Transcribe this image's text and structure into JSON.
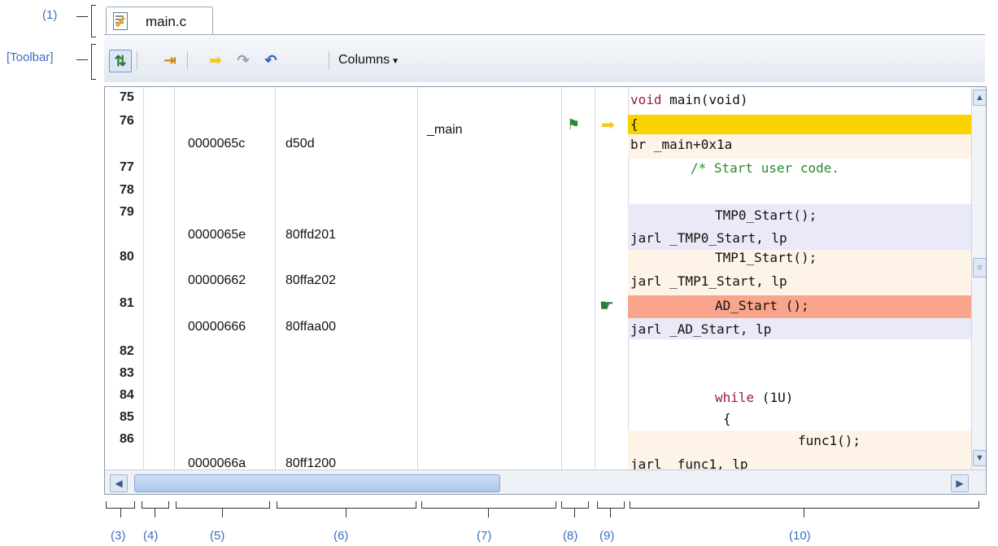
{
  "callouts": {
    "c1": "(1)",
    "toolbar": "[Toolbar]",
    "c3": "(3)",
    "c4": "(4)",
    "c5": "(5)",
    "c6": "(6)",
    "c7": "(7)",
    "c8": "(8)",
    "c9": "(9)",
    "c10": "(10)"
  },
  "tab": {
    "label": "main.c",
    "icon": "edit-document-icon"
  },
  "toolbar": {
    "columns_label": "Columns",
    "buttons": [
      "show-mixed-display-icon",
      "go-to-function-icon",
      "current-pc-arrow-icon",
      "step-over-icon",
      "return-icon"
    ]
  },
  "colors": {
    "pc_line": "#f8d300",
    "breakpoint_line": "#f9a58c",
    "asm_line": "#e9e9f8",
    "src_line": "#fdf3e6",
    "keyword": "#9b1c3d",
    "comment": "#2a8a2a"
  },
  "lines": [
    {
      "ln": "75",
      "code_kw": "void",
      "code_rest": " main(void)"
    },
    {
      "ln": "76",
      "symbol": "_main",
      "code": "{"
    },
    {
      "address": "0000065c",
      "hex": "d50d",
      "code": "br _main+0x1a"
    },
    {
      "ln": "77",
      "comment": "/* Start user code."
    },
    {
      "ln": "78"
    },
    {
      "ln": "79",
      "code": "TMP0_Start();"
    },
    {
      "address": "0000065e",
      "hex": "80ffd201",
      "code": "jarl _TMP0_Start, lp"
    },
    {
      "ln": "80",
      "code": "TMP1_Start();"
    },
    {
      "address": "00000662",
      "hex": "80ffa202",
      "code": "jarl _TMP1_Start, lp"
    },
    {
      "ln": "81",
      "code": "AD_Start ();"
    },
    {
      "address": "00000666",
      "hex": "80ffaa00",
      "code": "jarl _AD_Start, lp"
    },
    {
      "ln": "82"
    },
    {
      "ln": "83"
    },
    {
      "ln": "84",
      "code_kw": "while",
      "code_rest": " (1U)"
    },
    {
      "ln": "85",
      "code": "{"
    },
    {
      "ln": "86",
      "code": "func1();"
    },
    {
      "address": "0000066a",
      "hex": "80ff1200",
      "code": "jarl _func1, lp"
    }
  ]
}
